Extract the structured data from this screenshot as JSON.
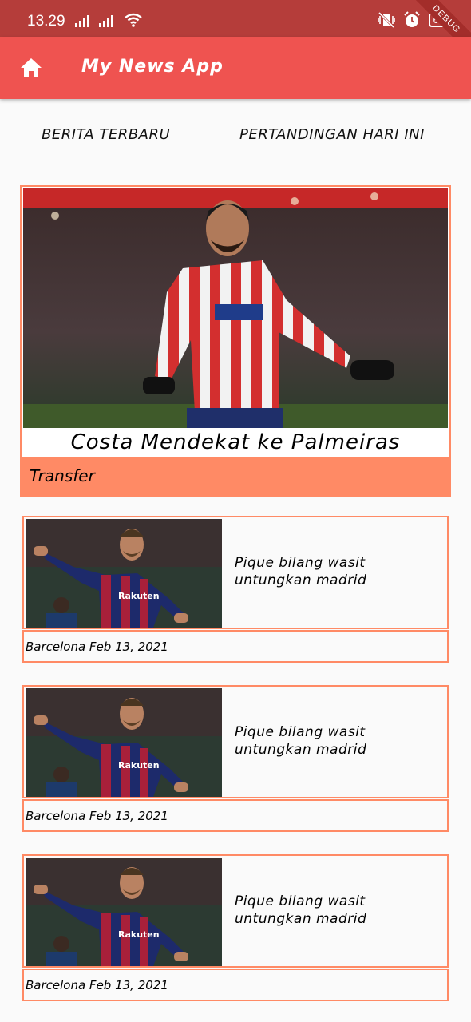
{
  "status_bar": {
    "time": "13.29",
    "battery": "65",
    "debug_label": "DEBUG"
  },
  "app_bar": {
    "title": "My News App",
    "home_icon": "home-icon"
  },
  "tabs": [
    {
      "label": "BERITA TERBARU"
    },
    {
      "label": "PERTANDINGAN HARI INI"
    }
  ],
  "featured": {
    "title": "Costa Mendekat ke Palmeiras",
    "category": "Transfer"
  },
  "news_list": [
    {
      "title_line1": "Pique bilang wasit",
      "title_line2": "untungkan madrid",
      "meta": "Barcelona Feb 13, 2021"
    },
    {
      "title_line1": "Pique bilang wasit",
      "title_line2": "untungkan madrid",
      "meta": "Barcelona Feb 13, 2021"
    },
    {
      "title_line1": "Pique bilang wasit",
      "title_line2": "untungkan madrid",
      "meta": "Barcelona Feb 13, 2021"
    }
  ],
  "colors": {
    "status_bar": "#b53d3a",
    "app_bar": "#ef5350",
    "accent": "#ff8a65",
    "background": "#fafafa"
  }
}
